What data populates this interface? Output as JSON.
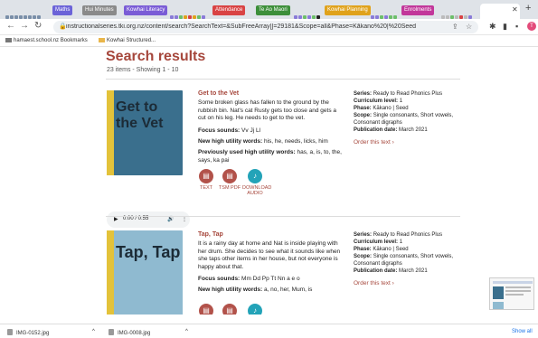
{
  "browser": {
    "tabs": [
      {
        "label": "Maths",
        "color": "#6b63d8"
      },
      {
        "label": "Hui Minutes",
        "color": "#8a8a8a"
      },
      {
        "label": "Kowhai Literacy",
        "color": "#7a5cd6"
      },
      {
        "label": "Attendance",
        "color": "#d94343"
      },
      {
        "label": "Te Ao Maori",
        "color": "#3d8f3a"
      },
      {
        "label": "Kowhai Planning",
        "color": "#e0a21b"
      },
      {
        "label": "Enrolments",
        "color": "#c2379a"
      }
    ],
    "url": "instructionalseries.tki.org.nz/content/search?SearchText=&SubFreeArray[]=29181&Scope=all&Phase=Kākano%20|%20Seed",
    "profile_initial": "T",
    "bookmarks": [
      "hamaest.school.nz Bookmarks",
      "Kowhai Structured..."
    ]
  },
  "page": {
    "title": "Search results",
    "count": "23 items - Showing 1 - 10"
  },
  "results": [
    {
      "title": "Get to the Vet",
      "cover_title": "Get to the Vet",
      "description": "Some broken glass has fallen to the ground by the rubbish bin. Nat's cat Rusty gets too close and gets a cut on his leg. He needs to get to the vet.",
      "focus_label": "Focus sounds:",
      "focus": "Vv Jj Ll",
      "hfw_label": "New high utility words:",
      "hfw": "his, he, needs, licks, him",
      "prev_label": "Previously used high utility words:",
      "prev": "has, a, is, to, the, says, ka pai",
      "meta": [
        {
          "label": "Series:",
          "value": "Ready to Read Phonics Plus"
        },
        {
          "label": "Curriculum level:",
          "value": "1"
        },
        {
          "label": "Phase:",
          "value": "Kākano | Seed"
        },
        {
          "label": "Scope:",
          "value": "Single consonants, Short vowels, Consonant digraphs"
        },
        {
          "label": "Publication date:",
          "value": "March 2021"
        }
      ],
      "order": "Order this text ›",
      "audio": {
        "time": "0:00 / 0:55"
      },
      "formats": [
        {
          "label": "TEXT",
          "icon": "book-icon",
          "color": "#b2524a"
        },
        {
          "label": "TSM PDF",
          "icon": "pdf-icon",
          "color": "#b2524a"
        },
        {
          "label": "DOWNLOAD AUDIO",
          "icon": "music-note-icon",
          "color": "#23a3b8"
        }
      ]
    },
    {
      "title": "Tap, Tap",
      "cover_title": "Tap, Tap",
      "description": "It is a rainy day at home and Nat is inside playing with her drum. She decides to see what it sounds like when she taps other items in her house, but not everyone is happy about that.",
      "focus_label": "Focus sounds:",
      "focus": "Mm Dd Pp Tt Nn a e o",
      "hfw_label": "New high utility words:",
      "hfw": "a, no, her, Mum, is",
      "meta": [
        {
          "label": "Series:",
          "value": "Ready to Read Phonics Plus"
        },
        {
          "label": "Curriculum level:",
          "value": "1"
        },
        {
          "label": "Phase:",
          "value": "Kākano | Seed"
        },
        {
          "label": "Scope:",
          "value": "Single consonants, Short vowels, Consonant digraphs"
        },
        {
          "label": "Publication date:",
          "value": "March 2021"
        }
      ],
      "order": "Order this text ›"
    }
  ],
  "downloads": {
    "items": [
      "IMG-0152.jpg",
      "IMG-0008.jpg"
    ],
    "show_all": "Show all"
  }
}
